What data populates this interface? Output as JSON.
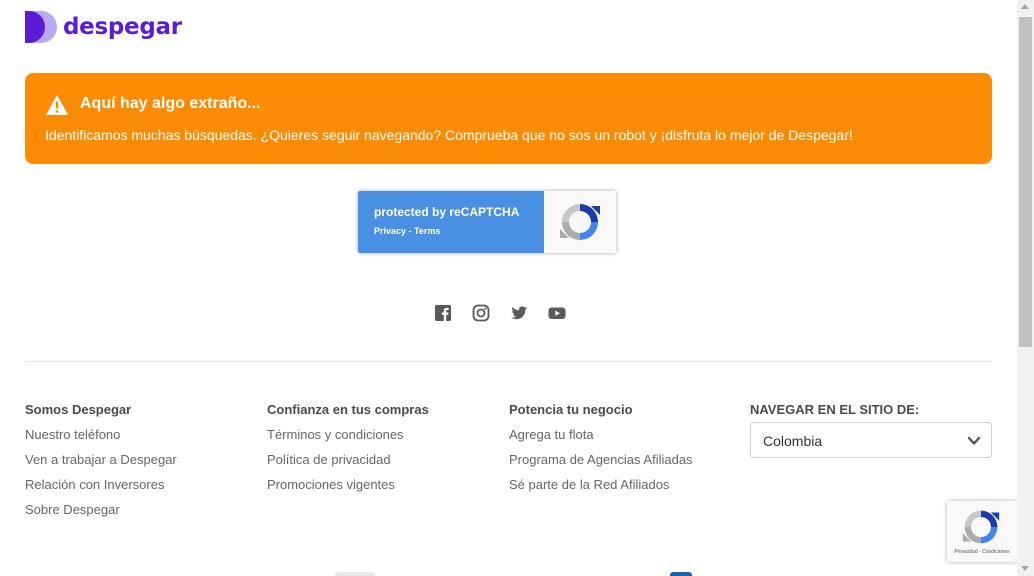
{
  "header": {
    "logo_text": "despegar"
  },
  "alert": {
    "icon": "warning-icon",
    "title": "Aquí hay algo extraño...",
    "message": "Identificamos muchas búsquedas. ¿Quieres seguir navegando? Comprueba que no sos un robot y ¡disfruta lo mejor de Despegar!",
    "color": "#fa8c05"
  },
  "recaptcha": {
    "title": "protected by reCAPTCHA",
    "privacy": "Privacy",
    "separator": " - ",
    "terms": "Terms",
    "color": "#4a90e2"
  },
  "social": {
    "icons": [
      "facebook-icon",
      "instagram-icon",
      "twitter-icon",
      "youtube-icon"
    ]
  },
  "footer": {
    "col1": {
      "title": "Somos Despegar",
      "links": [
        "Nuestro teléfono",
        "Ven a trabajar a Despegar",
        "Relación con Inversores",
        "Sobre Despegar"
      ]
    },
    "col2": {
      "title": "Confianza en tus compras",
      "links": [
        "Términos y condiciones",
        "Política de privacidad",
        "Promociones vigentes"
      ]
    },
    "col3": {
      "title": "Potencia tu negocio",
      "links": [
        "Agrega tu flota",
        "Programa de Agencias Afiliadas",
        "Sé parte de la Red Afiliados"
      ]
    },
    "col4": {
      "title": "NAVEGAR EN EL SITIO DE:",
      "selected_country": "Colombia"
    }
  },
  "recaptcha_float": {
    "text": "Privacidad - Condiciones"
  },
  "brand_color": "#5c1cd6"
}
